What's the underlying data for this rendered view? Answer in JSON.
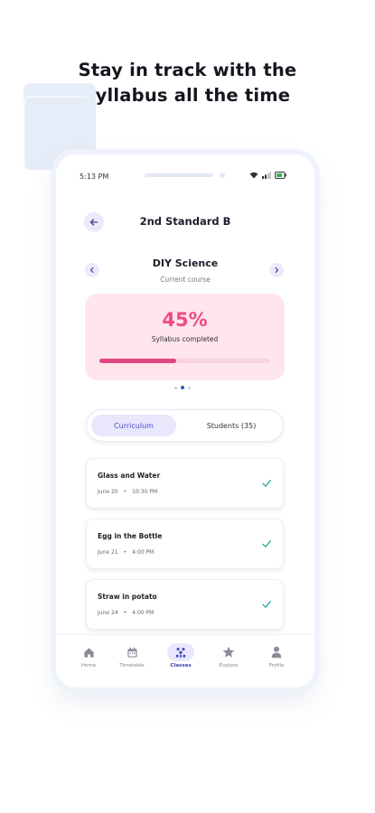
{
  "headline": {
    "line1": "Stay in track with the",
    "line2": "syllabus all the time"
  },
  "status_bar": {
    "time": "5:13 PM"
  },
  "header": {
    "title": "2nd Standard B"
  },
  "course": {
    "name": "DIY Science",
    "subtitle": "Current course"
  },
  "progress": {
    "percent_text": "45%",
    "label": "Syllabus completed",
    "fraction": 0.45
  },
  "carousel": {
    "page_count": 3,
    "active_index": 1
  },
  "tabs": [
    {
      "label": "Curriculum",
      "active": true
    },
    {
      "label": "Students (35)",
      "active": false
    }
  ],
  "lessons": [
    {
      "title": "Glass and Water",
      "date": "June 20",
      "time": "10:30 PM",
      "done": true
    },
    {
      "title": "Egg in the Bottle",
      "date": "June 21",
      "time": "4:00 PM",
      "done": true
    },
    {
      "title": "Straw in potato",
      "date": "June 24",
      "time": "4:00 PM",
      "done": true
    }
  ],
  "bottom_nav": [
    {
      "label": "Home",
      "icon": "home-icon",
      "active": false
    },
    {
      "label": "Timetable",
      "icon": "calendar-icon",
      "active": false
    },
    {
      "label": "Classes",
      "icon": "classes-icon",
      "active": true
    },
    {
      "label": "Explore",
      "icon": "star-icon",
      "active": false
    },
    {
      "label": "Profile",
      "icon": "profile-icon",
      "active": false
    }
  ],
  "colors": {
    "accent": "#4c46c8",
    "progress_pink": "#ef4b86",
    "card_pink_bg": "#ffe5ec",
    "check_green": "#2aa79b"
  }
}
